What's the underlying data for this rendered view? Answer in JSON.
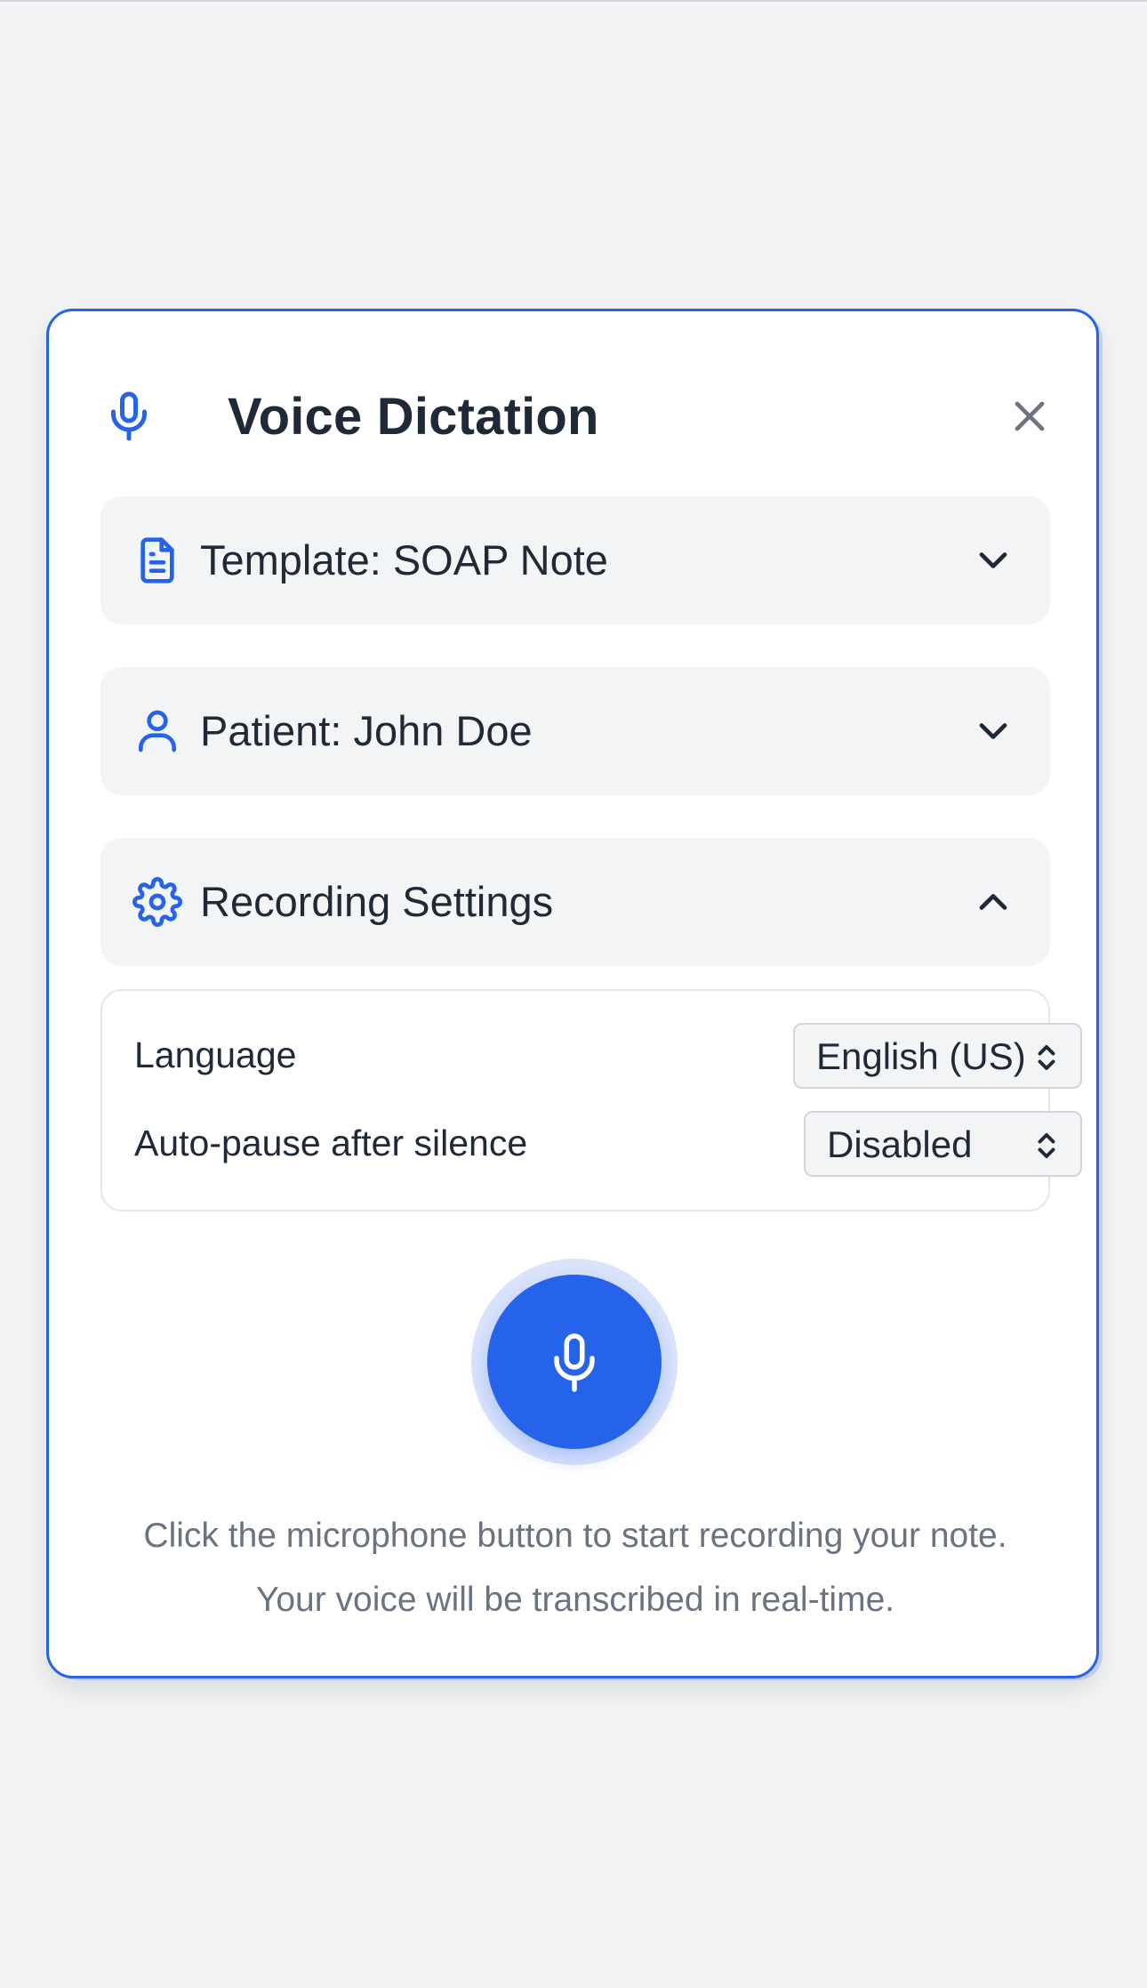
{
  "dialog": {
    "title": "Voice Dictation",
    "icons": {
      "title_icon": "microphone-icon",
      "close_icon": "close-icon"
    }
  },
  "accordions": [
    {
      "label": "Template: SOAP Note",
      "icon": "document-icon",
      "state": "collapsed"
    },
    {
      "label": "Patient: John Doe",
      "icon": "user-icon",
      "state": "collapsed"
    },
    {
      "label": "Recording Settings",
      "icon": "gear-icon",
      "state": "expanded"
    }
  ],
  "settings": {
    "language": {
      "label": "Language",
      "value": "English (US)"
    },
    "auto_pause": {
      "label": "Auto-pause after silence",
      "value": "Disabled"
    }
  },
  "record": {
    "icon": "microphone-icon"
  },
  "hint": {
    "line1": "Click the microphone button to start recording your note.",
    "line2": "Your voice will be transcribed in real-time."
  },
  "colors": {
    "accent": "#2563eb",
    "background": "#f2f3f5",
    "text": "#1f2937",
    "muted_text": "#6b7280"
  }
}
